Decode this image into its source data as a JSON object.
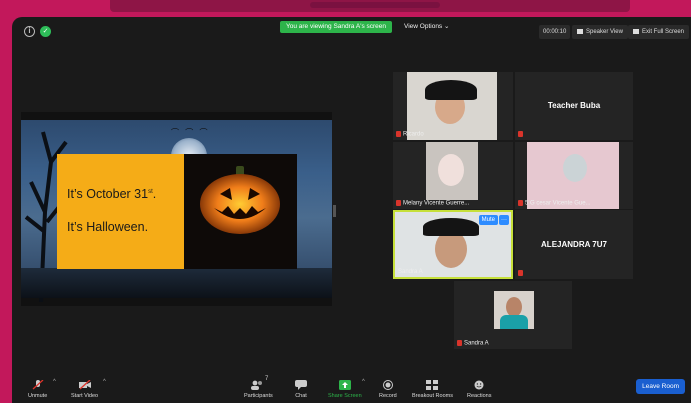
{
  "banner": {
    "viewing_text": "You are viewing Sandra A's screen",
    "view_options": "View Options ⌄"
  },
  "top_right": {
    "timer": "00:00:10",
    "speaker_view": "Speaker View",
    "exit_full_screen": "Exit Full Screen"
  },
  "slide": {
    "line1_main": "It’s October 31",
    "line1_sup": "st",
    "line1_end": ".",
    "line2": "It’s Halloween."
  },
  "participants": [
    {
      "name": "Ricardo",
      "mic_muted": true
    },
    {
      "name": "Teacher Buba",
      "mic_muted": true,
      "video": false
    },
    {
      "name": "Melany Vicente Guerre...",
      "mic_muted": true
    },
    {
      "name": "5 G cesar  Vicente Gue...",
      "mic_muted": true
    },
    {
      "name": "Sandra A",
      "mic_muted": false,
      "active_speaker": true,
      "mute_label": "Mute",
      "more_label": "···"
    },
    {
      "name": "ALEJANDRA 7U7",
      "mic_muted": true,
      "video": false
    },
    {
      "name": "Sandra A",
      "mic_muted": true
    }
  ],
  "toolbar": {
    "unmute": "Unmute",
    "start_video": "Start Video",
    "participants": "Participants",
    "participants_count": "7",
    "chat": "Chat",
    "share_screen": "Share Screen",
    "record": "Record",
    "breakout_rooms": "Breakout Rooms",
    "reactions": "Reactions",
    "leave_room": "Leave Room"
  },
  "colors": {
    "accent_green": "#2db44a",
    "active_border": "#c6e03a",
    "leave_blue": "#1a5fd0",
    "muted_red": "#d9342b",
    "frame_pink": "#c2185b"
  }
}
